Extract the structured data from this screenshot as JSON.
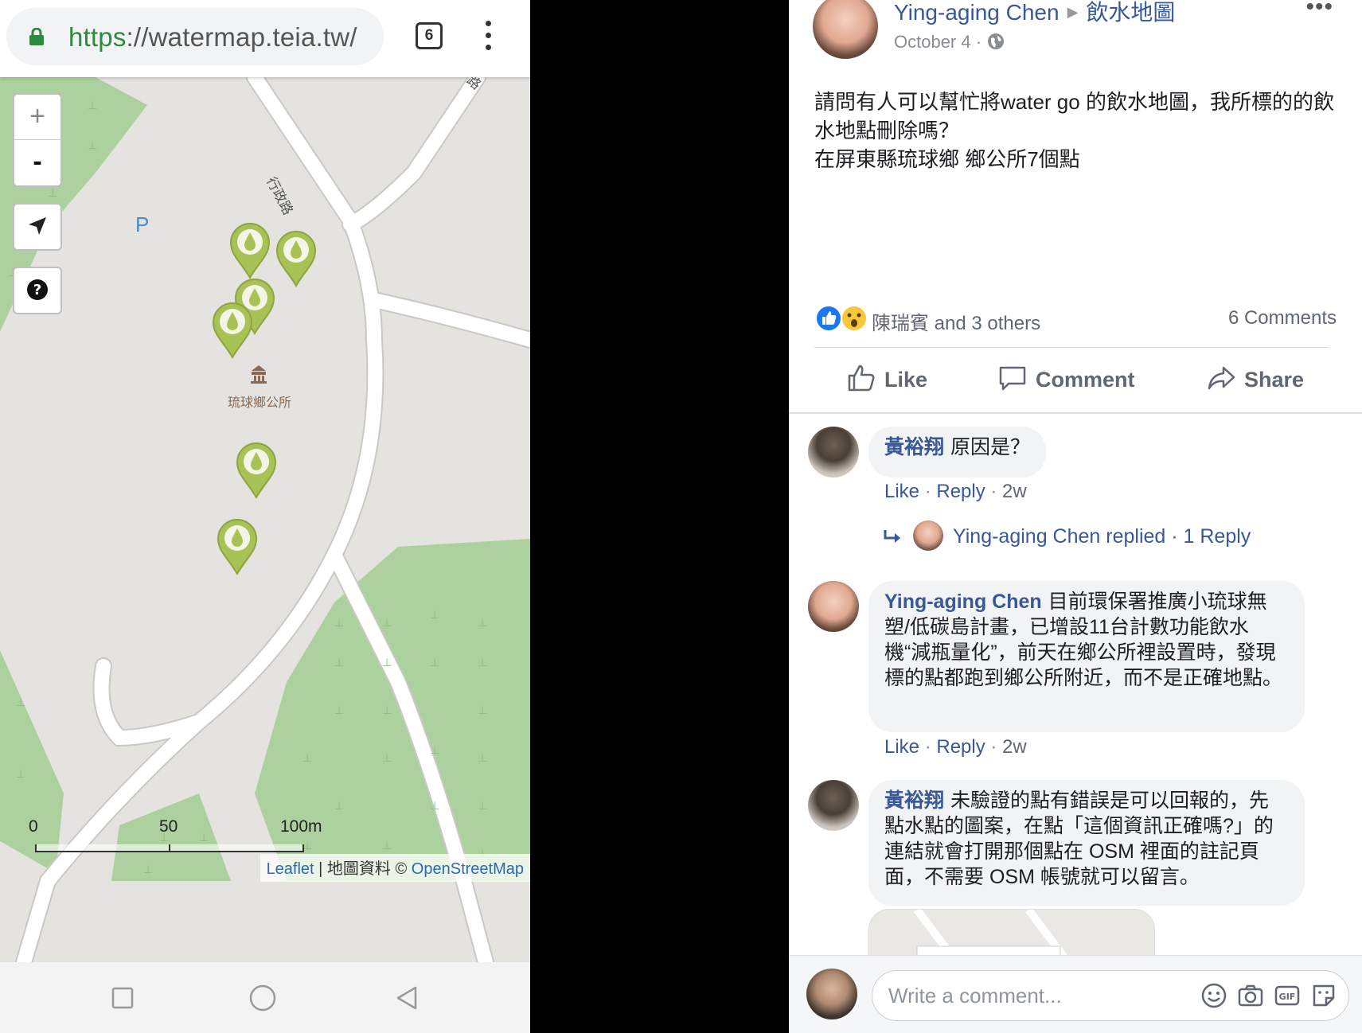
{
  "browser": {
    "url_scheme": "https",
    "url_rest": "://watermap.teia.tw/",
    "tab_count": "6"
  },
  "map": {
    "zoom_in": "+",
    "zoom_out": "-",
    "road_label": "行政路",
    "road_label_2": "路",
    "poi_label": "琉球鄉公所",
    "parking": "P",
    "scale": {
      "t0": "0",
      "t50": "50",
      "t100": "100m"
    },
    "attribution": {
      "leaflet": "Leaflet",
      "sep": " | 地圖資料 © ",
      "osm": "OpenStreetMap"
    },
    "colors": {
      "land": "#e4e3e0",
      "park": "#add19e",
      "road": "#ffffff",
      "marker": "#a9c256"
    }
  },
  "post": {
    "author": "Ying-aging Chen",
    "group": "飲水地圖",
    "date": "October 4 ·",
    "body": [
      "請問有人可以幫忙將water go 的飲水地圖，我所標的的飲水地點刪除嗎？",
      "在屏東縣琉球鄉 鄉公所7個點"
    ],
    "reactions": "陳瑞賓 and 3 others",
    "comment_count": "6 Comments",
    "actions": {
      "like": "Like",
      "comment": "Comment",
      "share": "Share"
    }
  },
  "comments": [
    {
      "author": "黃裕翔",
      "text": "原因是？",
      "like": "Like",
      "reply": "Reply",
      "time": "2w"
    },
    {
      "author": "Ying-aging Chen",
      "text": "目前環保署推廣小琉球無塑/低碳島計畫，已增設11台計數功能飲水機“減瓶量化”，前天在鄉公所裡設置時，發現標的點都跑到鄉公所附近，而不是正確地點。",
      "like": "Like",
      "reply": "Reply",
      "time": "2w"
    },
    {
      "author": "黃裕翔",
      "text": "未驗證的點有錯誤是可以回報的，先點水點的圖案，在點「這個資訊正確嗎?」的連結就會打開那個點在 OSM 裡面的註記頁面，不需要 OSM 帳號就可以留言。"
    }
  ],
  "reply_summary": "Ying-aging Chen replied · 1 Reply",
  "composer": {
    "placeholder": "Write a comment..."
  }
}
